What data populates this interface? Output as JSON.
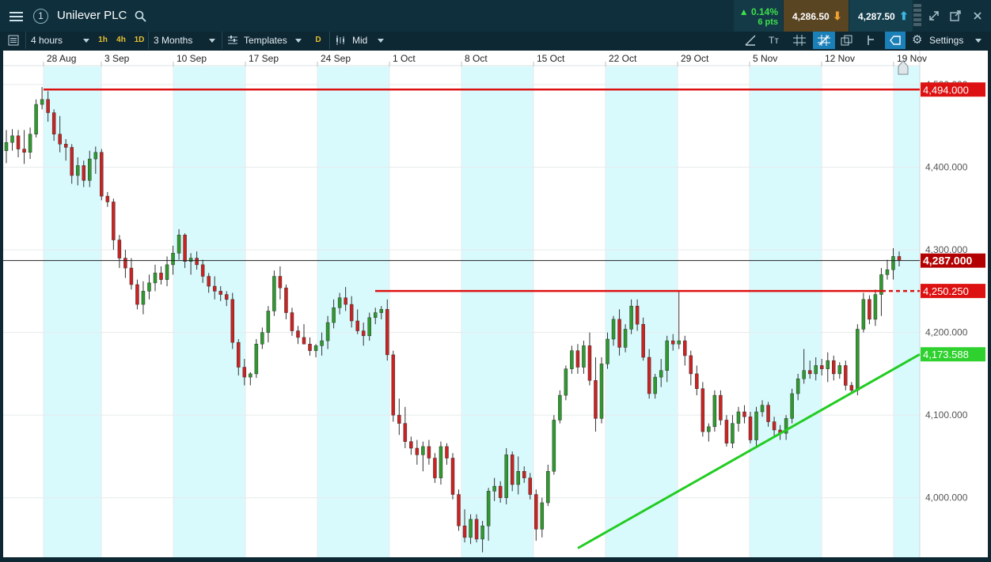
{
  "header": {
    "title": "Unilever PLC",
    "badge": "1",
    "change_pct": "▲ 0.14%",
    "change_pts": "6 pts",
    "sell_price": "4,286.50",
    "buy_price": "4,287.50",
    "icons": [
      "menu-icon",
      "search-icon",
      "expand-icon",
      "popout-icon",
      "close-icon"
    ]
  },
  "toolbar": {
    "interval": "4 hours",
    "tf_1h": "1h",
    "tf_4h": "4h",
    "tf_1d": "1D",
    "range": "3 Months",
    "templates": "Templates",
    "d_btn": "D",
    "price_type": "Mid",
    "settings": "Settings"
  },
  "colors": {
    "up_candle": "#2e9a2e",
    "down_candle": "#cc2222",
    "resistance": "#dd1111",
    "support": "#22cc22",
    "band": "#d9fafd"
  },
  "chart_data": {
    "type": "candlestick",
    "title": "Unilever PLC",
    "x_tick_labels": [
      "28 Aug",
      "3 Sep",
      "10 Sep",
      "17 Sep",
      "24 Sep",
      "1 Oct",
      "8 Oct",
      "15 Oct",
      "22 Oct",
      "29 Oct",
      "5 Nov",
      "12 Nov",
      "19 Nov"
    ],
    "y_tick_labels": [
      "4,500.000",
      "4,400.000",
      "4,300.000",
      "4,200.000",
      "4,100.000",
      "4,000.000"
    ],
    "y_ticks": [
      4500,
      4400,
      4300,
      4200,
      4100,
      4000
    ],
    "ylim": [
      3928,
      4522
    ],
    "current_price": 4287,
    "current_price_label": "4,287.000",
    "horizontal_lines": [
      {
        "label": "4,494.000",
        "value": 4494,
        "color": "#dd1111"
      },
      {
        "label": "4,250.250",
        "value": 4250.25,
        "color": "#dd1111"
      }
    ],
    "trendline": {
      "label": "4,173.588",
      "start_date": "17 Oct",
      "start_value": 3939,
      "end_value": 4173.588,
      "color": "#22cc22"
    },
    "candles_ohlc": [
      [
        4420,
        4445,
        4405,
        4430
      ],
      [
        4430,
        4446,
        4420,
        4438
      ],
      [
        4438,
        4445,
        4412,
        4422
      ],
      [
        4422,
        4445,
        4404,
        4418
      ],
      [
        4418,
        4448,
        4410,
        4440
      ],
      [
        4440,
        4482,
        4436,
        4476
      ],
      [
        4476,
        4497,
        4470,
        4482
      ],
      [
        4482,
        4492,
        4455,
        4466
      ],
      [
        4466,
        4470,
        4432,
        4440
      ],
      [
        4440,
        4462,
        4418,
        4428
      ],
      [
        4428,
        4434,
        4408,
        4424
      ],
      [
        4424,
        4428,
        4380,
        4390
      ],
      [
        4390,
        4412,
        4378,
        4402
      ],
      [
        4402,
        4408,
        4376,
        4384
      ],
      [
        4384,
        4420,
        4376,
        4410
      ],
      [
        4410,
        4425,
        4392,
        4418
      ],
      [
        4418,
        4422,
        4360,
        4365
      ],
      [
        4365,
        4370,
        4352,
        4358
      ],
      [
        4358,
        4362,
        4300,
        4312
      ],
      [
        4312,
        4318,
        4278,
        4290
      ],
      [
        4290,
        4300,
        4266,
        4278
      ],
      [
        4278,
        4290,
        4252,
        4258
      ],
      [
        4258,
        4264,
        4228,
        4234
      ],
      [
        4234,
        4262,
        4222,
        4250
      ],
      [
        4250,
        4270,
        4240,
        4260
      ],
      [
        4260,
        4282,
        4250,
        4272
      ],
      [
        4272,
        4280,
        4258,
        4264
      ],
      [
        4264,
        4292,
        4256,
        4282
      ],
      [
        4282,
        4305,
        4270,
        4296
      ],
      [
        4296,
        4325,
        4288,
        4318
      ],
      [
        4318,
        4320,
        4278,
        4286
      ],
      [
        4286,
        4296,
        4270,
        4290
      ],
      [
        4290,
        4298,
        4276,
        4282
      ],
      [
        4282,
        4288,
        4260,
        4268
      ],
      [
        4268,
        4272,
        4248,
        4256
      ],
      [
        4256,
        4268,
        4240,
        4250
      ],
      [
        4250,
        4256,
        4238,
        4246
      ],
      [
        4246,
        4250,
        4232,
        4240
      ],
      [
        4240,
        4248,
        4180,
        4188
      ],
      [
        4188,
        4192,
        4148,
        4158
      ],
      [
        4158,
        4168,
        4136,
        4146
      ],
      [
        4146,
        4152,
        4136,
        4150
      ],
      [
        4150,
        4192,
        4145,
        4186
      ],
      [
        4186,
        4206,
        4180,
        4200
      ],
      [
        4200,
        4232,
        4188,
        4226
      ],
      [
        4226,
        4275,
        4220,
        4268
      ],
      [
        4268,
        4280,
        4240,
        4254
      ],
      [
        4254,
        4258,
        4216,
        4224
      ],
      [
        4224,
        4230,
        4196,
        4202
      ],
      [
        4202,
        4208,
        4186,
        4194
      ],
      [
        4194,
        4210,
        4186,
        4186
      ],
      [
        4186,
        4194,
        4172,
        4178
      ],
      [
        4178,
        4186,
        4170,
        4184
      ],
      [
        4184,
        4200,
        4172,
        4190
      ],
      [
        4190,
        4220,
        4180,
        4212
      ],
      [
        4212,
        4240,
        4205,
        4230
      ],
      [
        4230,
        4248,
        4222,
        4242
      ],
      [
        4242,
        4255,
        4226,
        4234
      ],
      [
        4234,
        4244,
        4206,
        4214
      ],
      [
        4214,
        4228,
        4198,
        4202
      ],
      [
        4202,
        4212,
        4184,
        4196
      ],
      [
        4196,
        4224,
        4190,
        4218
      ],
      [
        4218,
        4230,
        4210,
        4224
      ],
      [
        4224,
        4232,
        4216,
        4228
      ],
      [
        4228,
        4240,
        4166,
        4173
      ],
      [
        4173,
        4178,
        4092,
        4100
      ],
      [
        4100,
        4120,
        4076,
        4090
      ],
      [
        4090,
        4110,
        4060,
        4068
      ],
      [
        4068,
        4074,
        4052,
        4060
      ],
      [
        4060,
        4070,
        4040,
        4052
      ],
      [
        4052,
        4068,
        4032,
        4062
      ],
      [
        4062,
        4070,
        4040,
        4048
      ],
      [
        4048,
        4054,
        4018,
        4024
      ],
      [
        4024,
        4068,
        4016,
        4062
      ],
      [
        4062,
        4066,
        4040,
        4048
      ],
      [
        4048,
        4054,
        3998,
        4004
      ],
      [
        4004,
        4010,
        3960,
        3966
      ],
      [
        3966,
        3986,
        3946,
        3952
      ],
      [
        3952,
        3980,
        3944,
        3974
      ],
      [
        3974,
        3980,
        3946,
        3950
      ],
      [
        3950,
        3972,
        3934,
        3966
      ],
      [
        3966,
        4012,
        3948,
        4008
      ],
      [
        4008,
        4024,
        3996,
        4014
      ],
      [
        4014,
        4020,
        3994,
        4000
      ],
      [
        4000,
        4060,
        3992,
        4052
      ],
      [
        4052,
        4056,
        4008,
        4016
      ],
      [
        4016,
        4050,
        4004,
        4032
      ],
      [
        4032,
        4038,
        4018,
        4024
      ],
      [
        4024,
        4030,
        3998,
        4004
      ],
      [
        4004,
        4010,
        3948,
        3962
      ],
      [
        3962,
        4000,
        3952,
        3994
      ],
      [
        3994,
        4040,
        3990,
        4032
      ],
      [
        4032,
        4100,
        4028,
        4094
      ],
      [
        4094,
        4130,
        4090,
        4124
      ],
      [
        4124,
        4160,
        4118,
        4156
      ],
      [
        4156,
        4184,
        4150,
        4178
      ],
      [
        4178,
        4186,
        4150,
        4158
      ],
      [
        4158,
        4190,
        4150,
        4184
      ],
      [
        4184,
        4200,
        4136,
        4142
      ],
      [
        4142,
        4170,
        4080,
        4096
      ],
      [
        4096,
        4170,
        4090,
        4162
      ],
      [
        4162,
        4200,
        4156,
        4192
      ],
      [
        4192,
        4220,
        4184,
        4216
      ],
      [
        4216,
        4228,
        4172,
        4182
      ],
      [
        4182,
        4210,
        4176,
        4204
      ],
      [
        4204,
        4240,
        4198,
        4232
      ],
      [
        4232,
        4240,
        4202,
        4210
      ],
      [
        4210,
        4218,
        4166,
        4170
      ],
      [
        4170,
        4180,
        4120,
        4126
      ],
      [
        4126,
        4150,
        4120,
        4146
      ],
      [
        4146,
        4168,
        4134,
        4154
      ],
      [
        4154,
        4196,
        4140,
        4190
      ],
      [
        4190,
        4198,
        4178,
        4186
      ],
      [
        4186,
        4250,
        4180,
        4190
      ],
      [
        4190,
        4196,
        4160,
        4172
      ],
      [
        4172,
        4178,
        4136,
        4150
      ],
      [
        4150,
        4160,
        4124,
        4132
      ],
      [
        4132,
        4140,
        4074,
        4080
      ],
      [
        4080,
        4090,
        4068,
        4086
      ],
      [
        4086,
        4130,
        4080,
        4124
      ],
      [
        4124,
        4130,
        4088,
        4094
      ],
      [
        4094,
        4100,
        4062,
        4066
      ],
      [
        4066,
        4100,
        4060,
        4090
      ],
      [
        4090,
        4110,
        4080,
        4104
      ],
      [
        4104,
        4112,
        4090,
        4098
      ],
      [
        4098,
        4104,
        4066,
        4070
      ],
      [
        4070,
        4110,
        4060,
        4104
      ],
      [
        4104,
        4118,
        4098,
        4112
      ],
      [
        4112,
        4116,
        4086,
        4092
      ],
      [
        4092,
        4098,
        4074,
        4082
      ],
      [
        4082,
        4088,
        4070,
        4078
      ],
      [
        4078,
        4100,
        4070,
        4096
      ],
      [
        4096,
        4132,
        4090,
        4126
      ],
      [
        4126,
        4150,
        4118,
        4144
      ],
      [
        4144,
        4180,
        4138,
        4154
      ],
      [
        4154,
        4166,
        4144,
        4150
      ],
      [
        4150,
        4170,
        4142,
        4160
      ],
      [
        4160,
        4168,
        4148,
        4156
      ],
      [
        4156,
        4176,
        4140,
        4166
      ],
      [
        4166,
        4172,
        4142,
        4150
      ],
      [
        4150,
        4164,
        4144,
        4160
      ],
      [
        4160,
        4166,
        4130,
        4136
      ],
      [
        4136,
        4140,
        4126,
        4130
      ],
      [
        4130,
        4210,
        4124,
        4204
      ],
      [
        4204,
        4248,
        4200,
        4240
      ],
      [
        4240,
        4245,
        4210,
        4216
      ],
      [
        4216,
        4252,
        4208,
        4246
      ],
      [
        4246,
        4278,
        4220,
        4270
      ],
      [
        4270,
        4288,
        4264,
        4276
      ],
      [
        4276,
        4302,
        4264,
        4292
      ],
      [
        4292,
        4298,
        4280,
        4287
      ]
    ]
  }
}
